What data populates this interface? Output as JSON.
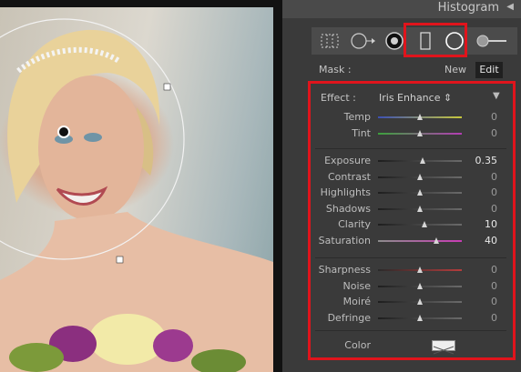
{
  "panel": {
    "title": "Histogram",
    "collapse_icon": "triangle-left-icon",
    "tools": [
      {
        "name": "crop-overlay-tool",
        "icon": "crop-grid-icon"
      },
      {
        "name": "spot-removal-tool",
        "icon": "spot-removal-icon"
      },
      {
        "name": "red-eye-tool",
        "icon": "red-eye-icon"
      },
      {
        "name": "graduated-filter-tool",
        "icon": "rectangle-icon"
      },
      {
        "name": "radial-filter-tool",
        "icon": "circle-icon"
      },
      {
        "name": "adjustment-brush-tool",
        "icon": "brush-icon"
      }
    ]
  },
  "mask": {
    "label": "Mask :",
    "new_label": "New",
    "edit_label": "Edit"
  },
  "effect": {
    "label": "Effect :",
    "value": "Iris Enhance",
    "select_icon": "up-down-arrows-icon",
    "collapse_icon": "triangle-down-icon"
  },
  "groups": [
    [
      {
        "label": "Temp",
        "value": "0",
        "level": 0.5,
        "track": [
          "#3c50b4",
          "#c8c83c"
        ]
      },
      {
        "label": "Tint",
        "value": "0",
        "level": 0.5,
        "track": [
          "#3ca03c",
          "#b43cb4"
        ]
      }
    ],
    [
      {
        "label": "Exposure",
        "value": "0.35",
        "level": 0.53,
        "strong": true
      },
      {
        "label": "Contrast",
        "value": "0",
        "level": 0.5
      },
      {
        "label": "Highlights",
        "value": "0",
        "level": 0.5
      },
      {
        "label": "Shadows",
        "value": "0",
        "level": 0.5
      },
      {
        "label": "Clarity",
        "value": "10",
        "level": 0.55,
        "strong": true
      },
      {
        "label": "Saturation",
        "value": "40",
        "level": 0.7,
        "strong": true,
        "track": [
          "#8c8c8c",
          "#c83cb4"
        ]
      }
    ],
    [
      {
        "label": "Sharpness",
        "value": "0",
        "level": 0.5,
        "track": [
          "#2a2a2a",
          "#b43c3c"
        ]
      },
      {
        "label": "Noise",
        "value": "0",
        "level": 0.5
      },
      {
        "label": "Moiré",
        "value": "0",
        "level": 0.5
      },
      {
        "label": "Defringe",
        "value": "0",
        "level": 0.5
      }
    ]
  ],
  "color": {
    "label": "Color",
    "swatch_icon": "no-color-swatch-icon"
  },
  "colors": {
    "highlight": "#e0141c",
    "panel_bg": "#3a3a3a",
    "header_bg": "#4a4a4a"
  }
}
